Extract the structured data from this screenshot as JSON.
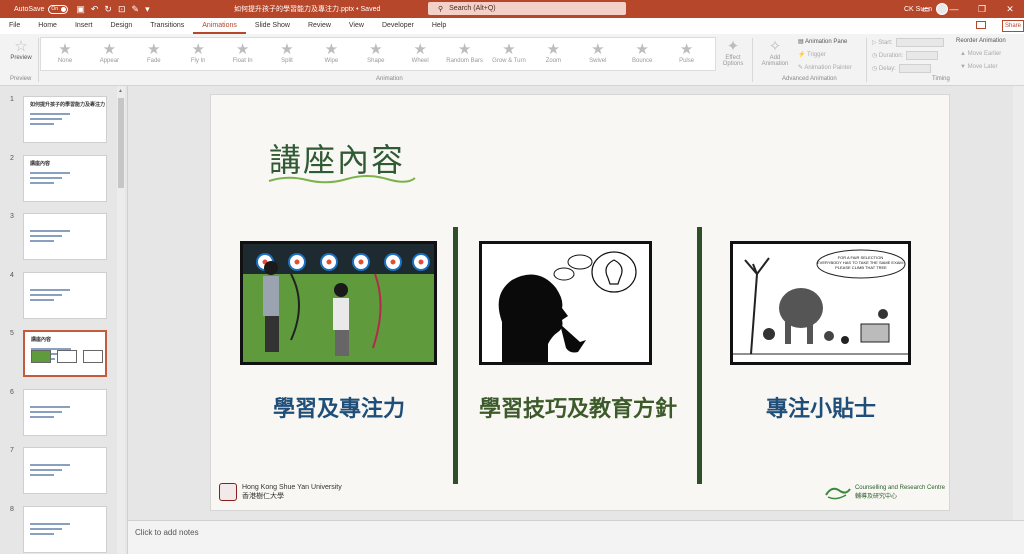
{
  "titlebar": {
    "autosave_label": "AutoSave",
    "autosave_state": "On",
    "doc_title": "如何提升孩子的學習能力及專注力.pptx • Saved",
    "search_placeholder": "Search (Alt+Q)",
    "user_name": "CK Suen"
  },
  "tabs": [
    "File",
    "Home",
    "Insert",
    "Design",
    "Transitions",
    "Animations",
    "Slide Show",
    "Review",
    "View",
    "Developer",
    "Help"
  ],
  "active_tab": "Animations",
  "share_label": "Share",
  "ribbon": {
    "preview_label": "Preview",
    "preview_group": "Preview",
    "animations": [
      "None",
      "Appear",
      "Fade",
      "Fly In",
      "Float In",
      "Split",
      "Wipe",
      "Shape",
      "Wheel",
      "Random Bars",
      "Grow & Turn",
      "Zoom",
      "Swivel",
      "Bounce",
      "Pulse"
    ],
    "animation_group": "Animation",
    "effect_options": "Effect Options",
    "add_animation": "Add Animation",
    "animation_pane": "Animation Pane",
    "trigger": "Trigger",
    "animation_painter": "Animation Painter",
    "advanced_group": "Advanced Animation",
    "start": "Start:",
    "duration": "Duration:",
    "delay": "Delay:",
    "timing_group": "Timing",
    "reorder": "Reorder Animation",
    "move_earlier": "Move Earlier",
    "move_later": "Move Later"
  },
  "thumbnails": [
    {
      "num": "1",
      "title": "如何提升孩子的學習能力及專注力"
    },
    {
      "num": "2",
      "title": "講座內容"
    },
    {
      "num": "3",
      "title": ""
    },
    {
      "num": "4",
      "title": ""
    },
    {
      "num": "5",
      "title": "講座內容"
    },
    {
      "num": "6",
      "title": ""
    },
    {
      "num": "7",
      "title": ""
    },
    {
      "num": "8",
      "title": ""
    }
  ],
  "slide": {
    "title": "講座內容",
    "captions": [
      "學習及專注力",
      "學習技巧及教育方針",
      "專注小貼士"
    ],
    "cartoon_text": "FOR A FAIR SELECTION EVERYBODY HAS TO TAKE THE SAME EXAM: PLEASE CLIMB THAT TREE",
    "logo_left_en": "Hong Kong Shue Yan University",
    "logo_left_zh": "香港樹仁大學",
    "logo_right_en": "Counselling and Research Centre",
    "logo_right_zh": "輔導及研究中心"
  },
  "notes_placeholder": "Click to add notes"
}
